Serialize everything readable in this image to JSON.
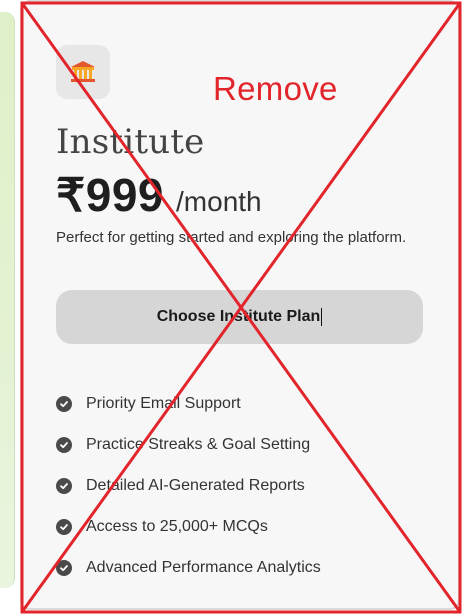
{
  "plan": {
    "icon": "institute-building-icon",
    "name": "Institute",
    "price": "₹999",
    "period": "/month",
    "description": "Perfect for getting started and exploring the platform.",
    "cta_label": "Choose Institute Plan"
  },
  "features": [
    "Priority Email Support",
    "Practice Streaks & Goal Setting",
    "Detailed AI-Generated Reports",
    "Access to 25,000+ MCQs",
    "Advanced Performance Analytics"
  ],
  "annotation": {
    "text": "Remove",
    "color": "#e2242b"
  },
  "colors": {
    "card_background": "#f7f7f7",
    "button_background": "#d6d6d6",
    "accent_strip": "#e4f2d3"
  }
}
